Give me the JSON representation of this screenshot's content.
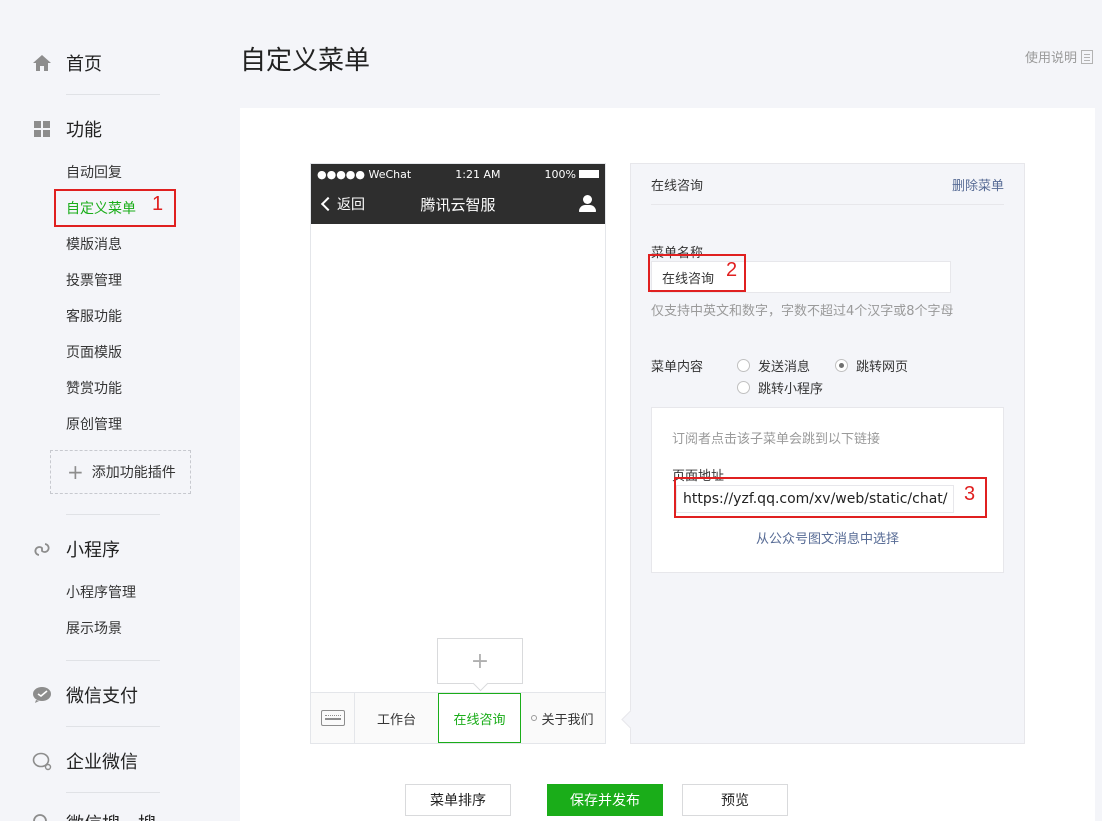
{
  "sidebar": {
    "groups": [
      {
        "label": "首页",
        "icon": "home-icon"
      },
      {
        "label": "功能",
        "icon": "grid-icon"
      },
      {
        "label": "小程序",
        "icon": "mini-program-icon"
      },
      {
        "label": "微信支付",
        "icon": "wechat-pay-icon"
      },
      {
        "label": "企业微信",
        "icon": "work-wechat-icon"
      },
      {
        "label": "微信搜一搜",
        "icon": "search-icon"
      }
    ],
    "function_items": [
      "自动回复",
      "自定义菜单",
      "模版消息",
      "投票管理",
      "客服功能",
      "页面模版",
      "赞赏功能",
      "原创管理"
    ],
    "add_plugin_label": "添加功能插件",
    "miniprogram_items": [
      "小程序管理",
      "展示场景"
    ]
  },
  "header": {
    "title": "自定义菜单",
    "help_label": "使用说明"
  },
  "phone": {
    "carrier": "●●●●● WeChat",
    "time": "1:21 AM",
    "battery": "100%",
    "back_label": "返回",
    "title": "腾讯云智服",
    "add_submenu_symbol": "+",
    "menu_items": [
      "工作台",
      "在线咨询",
      "关于我们"
    ]
  },
  "editor": {
    "menu_title": "在线咨询",
    "delete_label": "删除菜单",
    "name_label": "菜单名称",
    "name_value": "在线咨询",
    "name_hint": "仅支持中英文和数字，字数不超过4个汉字或8个字母",
    "content_label": "菜单内容",
    "options": [
      "发送消息",
      "跳转网页",
      "跳转小程序"
    ],
    "selected_option": "跳转网页",
    "url_desc": "订阅者点击该子菜单会跳到以下链接",
    "url_label": "页面地址",
    "url_value": "https://yzf.qq.com/xv/web/static/chat/",
    "pick_label": "从公众号图文消息中选择"
  },
  "annotations": [
    "1",
    "2",
    "3"
  ],
  "buttons": {
    "sort": "菜单排序",
    "save_publish": "保存并发布",
    "preview": "预览"
  },
  "colors": {
    "accent_green": "#1aad19",
    "link_blue": "#576b95",
    "annotation_red": "#e02020"
  }
}
